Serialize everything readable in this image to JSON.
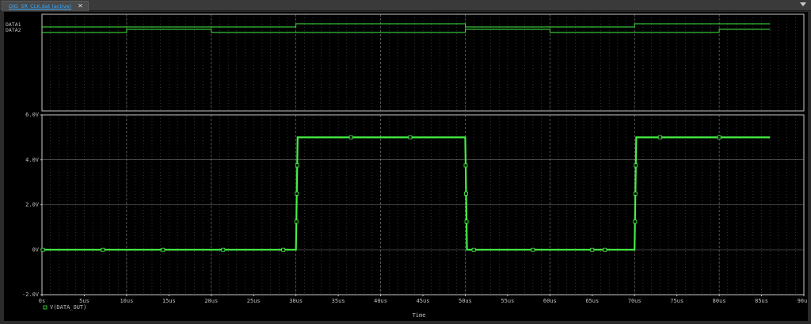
{
  "tab": {
    "title": "DIG_SR_CLK.dat (active)"
  },
  "colors": {
    "trace": "#44ee44",
    "grid": "#9a9a9a",
    "axis": "#c8c8c8",
    "text": "#c0c0c0",
    "background": "#000000"
  },
  "chart_data": [
    {
      "type": "digital",
      "signals": [
        {
          "name": "DATA1",
          "high_intervals_us": [
            [
              30,
              50
            ],
            [
              70,
              90
            ]
          ]
        },
        {
          "name": "DATA2",
          "high_intervals_us": [
            [
              10,
              20
            ],
            [
              50,
              60
            ],
            [
              80,
              90
            ]
          ]
        }
      ],
      "xlim": [
        0,
        86
      ]
    },
    {
      "type": "line",
      "xlabel": "Time",
      "x_ticks": [
        "0s",
        "5us",
        "10us",
        "15us",
        "20us",
        "25us",
        "30us",
        "35us",
        "40us",
        "45us",
        "50us",
        "55us",
        "60us",
        "65us",
        "70us",
        "75us",
        "80us",
        "85us",
        "90us"
      ],
      "y_ticks": [
        "6.0V",
        "4.0V",
        "2.0V",
        "0V",
        "-2.0V"
      ],
      "xlim": [
        0,
        90
      ],
      "ylim": [
        -2,
        6
      ],
      "grid": true,
      "series": [
        {
          "name": "V(DATA_OUT)",
          "x": [
            0,
            30,
            30.2,
            50,
            50.2,
            70,
            70.2,
            86
          ],
          "y": [
            0,
            0,
            5,
            5,
            0,
            0,
            5,
            5
          ],
          "markers_x": [
            0.1,
            7.2,
            14.3,
            21.4,
            28.5,
            30.05,
            30.1,
            30.15,
            36.5,
            43.5,
            50.05,
            50.1,
            50.15,
            51,
            58,
            65,
            66.5,
            70.05,
            70.1,
            70.15,
            73,
            80
          ]
        }
      ]
    }
  ]
}
